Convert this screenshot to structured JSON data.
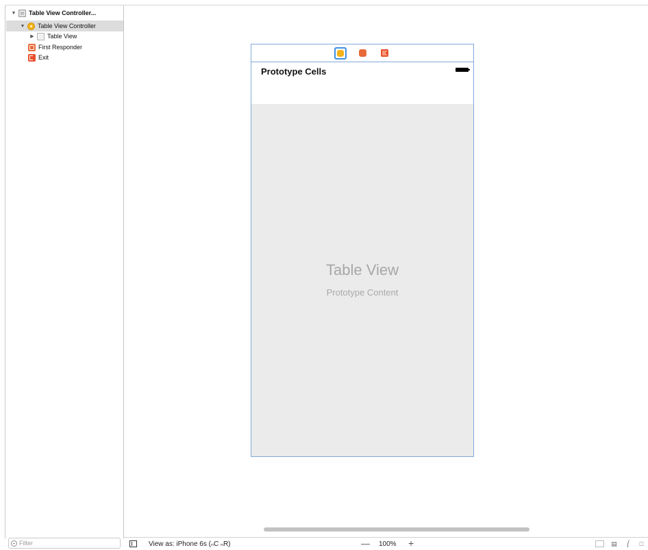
{
  "outline": {
    "items": [
      {
        "label": "Table View Controller..."
      },
      {
        "label": "Table View Controller"
      },
      {
        "label": "Table View"
      },
      {
        "label": "First Responder"
      },
      {
        "label": "Exit"
      }
    ],
    "filter_placeholder": "Filter"
  },
  "scene": {
    "prototype_cells_title": "Prototype Cells",
    "table_view_title": "Table View",
    "table_view_subtitle": "Prototype Content"
  },
  "bottom_bar": {
    "view_as_label": "View as: iPhone 6s (ₙC ₙR)",
    "zoom_out": "—",
    "zoom_level": "100%",
    "zoom_in": "+"
  },
  "colors": {
    "selection": "#dcdcdc",
    "scene_border": "#7fa9d6",
    "vc_icon": "#f5b319",
    "first_responder_icon": "#e86a3a",
    "exit_icon": "#e8502d",
    "table_background": "#ebebeb"
  },
  "icons": [
    "scene-icon",
    "view-controller-icon",
    "table-view-icon",
    "first-responder-icon",
    "exit-icon",
    "battery-icon",
    "filter-icon"
  ]
}
